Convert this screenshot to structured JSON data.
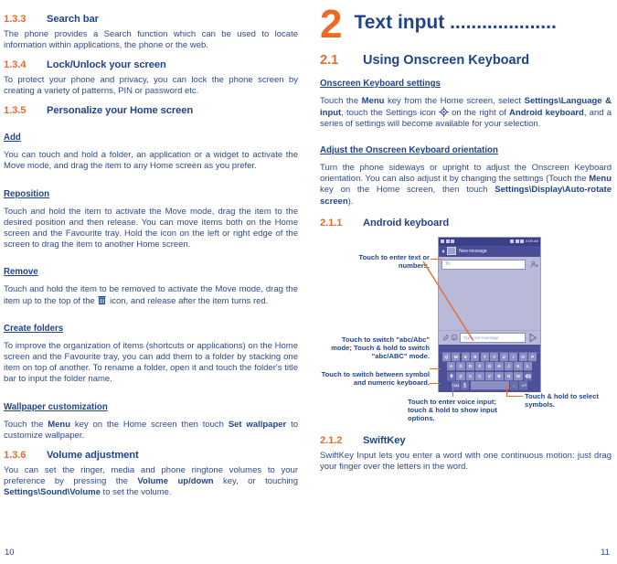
{
  "left_page": {
    "page_number": "10",
    "sections": [
      {
        "type": "h3",
        "num": "1.3.3",
        "title": "Search bar",
        "body": "The phone provides a Search function which can be used to locate information within applications, the phone or the web."
      },
      {
        "type": "h3",
        "num": "1.3.4",
        "title": "Lock/Unlock your screen",
        "body": "To protect your phone and privacy, you can lock the phone screen by creating a variety of patterns, PIN or password etc."
      },
      {
        "type": "h3",
        "num": "1.3.5",
        "title": "Personalize your Home screen"
      }
    ],
    "sub_add": "Add",
    "sub_add_body": "You can touch and hold a folder, an application or a widget to activate the Move mode, and drag the item to any Home screen as you prefer.",
    "sub_reposition": "Reposition ",
    "sub_reposition_body": "Touch and hold the item to activate the Move mode, drag the item to the desired position and then release. You can move items both on the Home screen and the Favourite tray. Hold the icon on the left or right edge of the screen to drag the item to another Home screen.",
    "sub_remove": "Remove",
    "sub_remove_body_1": "Touch and hold the item to be removed to activate the Move mode, drag the item up to the top of the ",
    "sub_remove_body_2": " icon, and release after the item turns red.",
    "trash_icon_name": "trash-icon",
    "sub_createfolders": "Create folders",
    "sub_createfolders_body": "To improve the organization of items (shortcuts or applications) on the Home screen and the Favourite tray, you can add them to a folder by stacking one item on top of another. To rename a folder, open it and touch the folder's title bar to input the folder name.",
    "sub_wallpaper": "Wallpaper customization",
    "sub_wallpaper_body_1": "Touch the ",
    "sub_wallpaper_bold_1": "Menu",
    "sub_wallpaper_body_2": " key on the Home screen then touch ",
    "sub_wallpaper_bold_2": "Set wallpaper",
    "sub_wallpaper_body_3": " to customize wallpaper.",
    "volume": {
      "num": "1.3.6",
      "title": "Volume adjustment",
      "body_1": "You can set the ringer, media and phone ringtone volumes to your preference by pressing the ",
      "bold_1": "Volume up/down",
      "body_2": " key, or touching ",
      "bold_2": "Settings\\Sound\\Volume",
      "body_3": " to set the volume."
    }
  },
  "right_page": {
    "page_number": "11",
    "chapter": {
      "number": "2",
      "title": "Text input ...................."
    },
    "section_2_1": {
      "num": "2.1",
      "title": "Using Onscreen Keyboard"
    },
    "onscreen_settings_heading": "Onscreen Keyboard settings",
    "onscreen_settings_body_1": "Touch the ",
    "onscreen_settings_bold_1": "Menu",
    "onscreen_settings_body_2": " key from the Home screen, select ",
    "onscreen_settings_bold_2": "Settings\\Language & input",
    "onscreen_settings_body_3": ", touch the Settings icon ",
    "gear_icon_name": "gear-icon",
    "onscreen_settings_body_4": " on the right of ",
    "onscreen_settings_bold_3": "Android keyboard",
    "onscreen_settings_body_5": ", and a series of settings will become available for your selection.",
    "orientation_heading": "Adjust the Onscreen Keyboard orientation",
    "orientation_body_1": "Turn the phone sideways or upright to adjust the Onscreen Keyboard orientation. You can also adjust it by changing the settings (Touch the ",
    "orientation_bold_1": "Menu",
    "orientation_body_2": " key on the Home screen, then touch ",
    "orientation_bold_2": "Settings\\Display\\Auto-rotate screen",
    "orientation_body_3": ").",
    "section_2_1_1": {
      "num": "2.1.1",
      "title": "Android keyboard"
    },
    "phone_mockup": {
      "status_time": "10:59 AM",
      "titlebar_text": "New message",
      "to_field_placeholder": "To",
      "compose_placeholder": "Type text message",
      "keyboard_rows": [
        [
          "Q",
          "W",
          "E",
          "R",
          "T",
          "Y",
          "U",
          "I",
          "O",
          "P"
        ],
        [
          "A",
          "S",
          "D",
          "F",
          "G",
          "H",
          "J",
          "K",
          "L"
        ],
        [
          "Z",
          "X",
          "C",
          "V",
          "B",
          "N",
          "M"
        ]
      ],
      "shift_key": "shift-key",
      "backspace_key": "backspace-key",
      "symbol_key": "?123",
      "mic_key": "microphone-key",
      "space_key": "space-key",
      "period_key": ".",
      "enter_key": "enter-key"
    },
    "annotations": [
      {
        "id": "anno-text-entry",
        "text": "Touch to enter text or numbers."
      },
      {
        "id": "anno-abc-mode",
        "text": "Touch to switch \"abc/Abc\" mode; Touch & hold to switch \"abc/ABC\" mode."
      },
      {
        "id": "anno-symbol-numeric",
        "text": "Touch to switch between symbol and numeric keyboard."
      },
      {
        "id": "anno-voice-input",
        "text": "Touch to enter voice input; touch & hold to show input options."
      },
      {
        "id": "anno-select-symbols",
        "text": "Touch & hold to select symbols."
      }
    ],
    "section_2_1_2": {
      "num": "2.1.2",
      "title": "SwiftKey",
      "body": "SwiftKey Input lets you enter a word with one continuous motion: just drag your finger over the letters in the word."
    }
  },
  "colors": {
    "accent_orange": "#ec6a28",
    "heading_blue": "#20448c",
    "body_blue": "#2d4a8a",
    "phone_body": "#b9bad9",
    "keyboard_bg": "#4c5099",
    "key_face": "#8b8fc4"
  }
}
